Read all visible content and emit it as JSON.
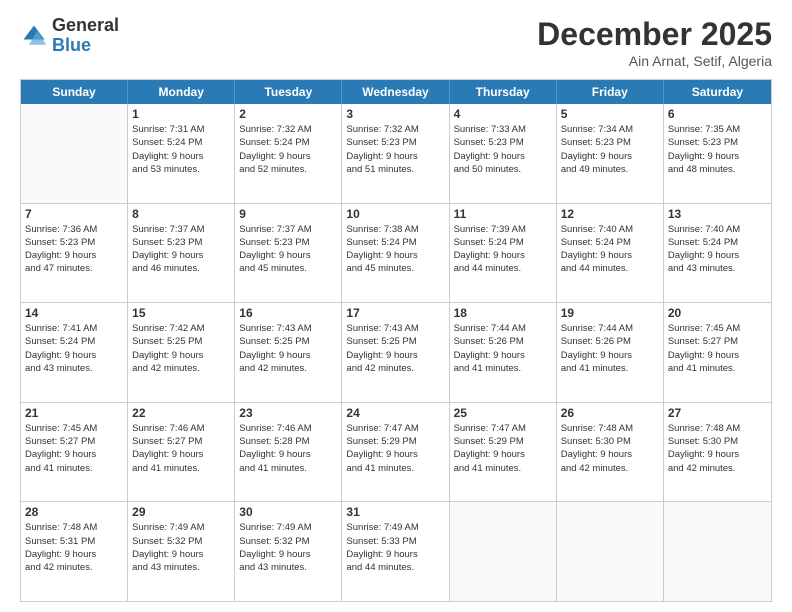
{
  "logo": {
    "general": "General",
    "blue": "Blue"
  },
  "header": {
    "title": "December 2025",
    "subtitle": "Ain Arnat, Setif, Algeria"
  },
  "weekdays": [
    "Sunday",
    "Monday",
    "Tuesday",
    "Wednesday",
    "Thursday",
    "Friday",
    "Saturday"
  ],
  "weeks": [
    [
      {
        "day": "",
        "empty": true
      },
      {
        "day": "1",
        "sunrise": "7:31 AM",
        "sunset": "5:24 PM",
        "daylight": "9 hours and 53 minutes."
      },
      {
        "day": "2",
        "sunrise": "7:32 AM",
        "sunset": "5:24 PM",
        "daylight": "9 hours and 52 minutes."
      },
      {
        "day": "3",
        "sunrise": "7:32 AM",
        "sunset": "5:23 PM",
        "daylight": "9 hours and 51 minutes."
      },
      {
        "day": "4",
        "sunrise": "7:33 AM",
        "sunset": "5:23 PM",
        "daylight": "9 hours and 50 minutes."
      },
      {
        "day": "5",
        "sunrise": "7:34 AM",
        "sunset": "5:23 PM",
        "daylight": "9 hours and 49 minutes."
      },
      {
        "day": "6",
        "sunrise": "7:35 AM",
        "sunset": "5:23 PM",
        "daylight": "9 hours and 48 minutes."
      }
    ],
    [
      {
        "day": "7",
        "sunrise": "7:36 AM",
        "sunset": "5:23 PM",
        "daylight": "9 hours and 47 minutes."
      },
      {
        "day": "8",
        "sunrise": "7:37 AM",
        "sunset": "5:23 PM",
        "daylight": "9 hours and 46 minutes."
      },
      {
        "day": "9",
        "sunrise": "7:37 AM",
        "sunset": "5:23 PM",
        "daylight": "9 hours and 45 minutes."
      },
      {
        "day": "10",
        "sunrise": "7:38 AM",
        "sunset": "5:24 PM",
        "daylight": "9 hours and 45 minutes."
      },
      {
        "day": "11",
        "sunrise": "7:39 AM",
        "sunset": "5:24 PM",
        "daylight": "9 hours and 44 minutes."
      },
      {
        "day": "12",
        "sunrise": "7:40 AM",
        "sunset": "5:24 PM",
        "daylight": "9 hours and 44 minutes."
      },
      {
        "day": "13",
        "sunrise": "7:40 AM",
        "sunset": "5:24 PM",
        "daylight": "9 hours and 43 minutes."
      }
    ],
    [
      {
        "day": "14",
        "sunrise": "7:41 AM",
        "sunset": "5:24 PM",
        "daylight": "9 hours and 43 minutes."
      },
      {
        "day": "15",
        "sunrise": "7:42 AM",
        "sunset": "5:25 PM",
        "daylight": "9 hours and 42 minutes."
      },
      {
        "day": "16",
        "sunrise": "7:43 AM",
        "sunset": "5:25 PM",
        "daylight": "9 hours and 42 minutes."
      },
      {
        "day": "17",
        "sunrise": "7:43 AM",
        "sunset": "5:25 PM",
        "daylight": "9 hours and 42 minutes."
      },
      {
        "day": "18",
        "sunrise": "7:44 AM",
        "sunset": "5:26 PM",
        "daylight": "9 hours and 41 minutes."
      },
      {
        "day": "19",
        "sunrise": "7:44 AM",
        "sunset": "5:26 PM",
        "daylight": "9 hours and 41 minutes."
      },
      {
        "day": "20",
        "sunrise": "7:45 AM",
        "sunset": "5:27 PM",
        "daylight": "9 hours and 41 minutes."
      }
    ],
    [
      {
        "day": "21",
        "sunrise": "7:45 AM",
        "sunset": "5:27 PM",
        "daylight": "9 hours and 41 minutes."
      },
      {
        "day": "22",
        "sunrise": "7:46 AM",
        "sunset": "5:27 PM",
        "daylight": "9 hours and 41 minutes."
      },
      {
        "day": "23",
        "sunrise": "7:46 AM",
        "sunset": "5:28 PM",
        "daylight": "9 hours and 41 minutes."
      },
      {
        "day": "24",
        "sunrise": "7:47 AM",
        "sunset": "5:29 PM",
        "daylight": "9 hours and 41 minutes."
      },
      {
        "day": "25",
        "sunrise": "7:47 AM",
        "sunset": "5:29 PM",
        "daylight": "9 hours and 41 minutes."
      },
      {
        "day": "26",
        "sunrise": "7:48 AM",
        "sunset": "5:30 PM",
        "daylight": "9 hours and 42 minutes."
      },
      {
        "day": "27",
        "sunrise": "7:48 AM",
        "sunset": "5:30 PM",
        "daylight": "9 hours and 42 minutes."
      }
    ],
    [
      {
        "day": "28",
        "sunrise": "7:48 AM",
        "sunset": "5:31 PM",
        "daylight": "9 hours and 42 minutes."
      },
      {
        "day": "29",
        "sunrise": "7:49 AM",
        "sunset": "5:32 PM",
        "daylight": "9 hours and 43 minutes."
      },
      {
        "day": "30",
        "sunrise": "7:49 AM",
        "sunset": "5:32 PM",
        "daylight": "9 hours and 43 minutes."
      },
      {
        "day": "31",
        "sunrise": "7:49 AM",
        "sunset": "5:33 PM",
        "daylight": "9 hours and 44 minutes."
      },
      {
        "day": "",
        "empty": true
      },
      {
        "day": "",
        "empty": true
      },
      {
        "day": "",
        "empty": true
      }
    ]
  ]
}
